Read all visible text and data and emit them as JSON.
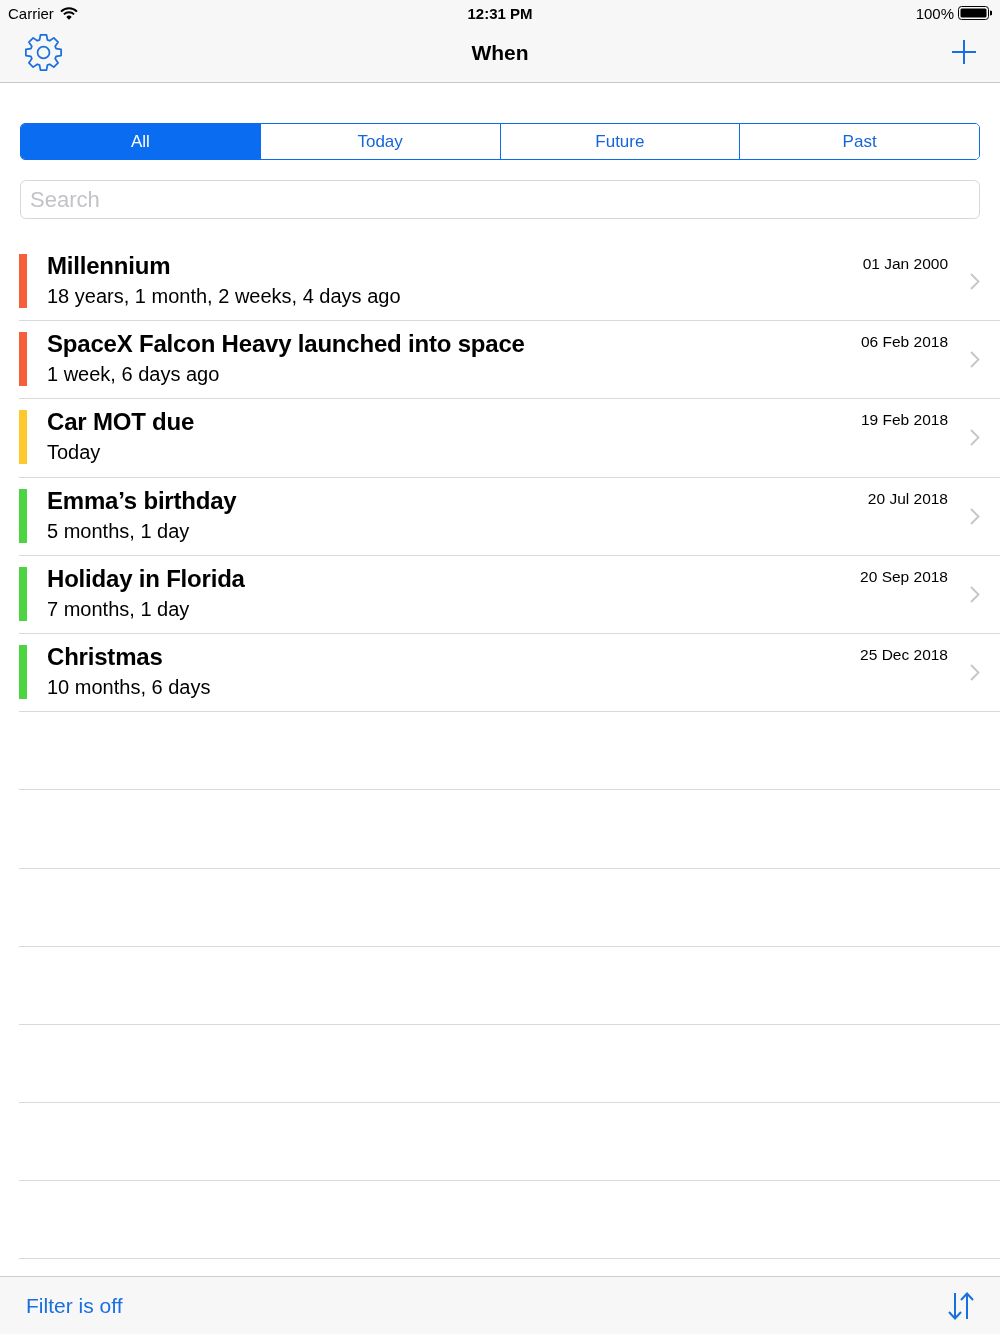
{
  "status_bar": {
    "carrier": "Carrier",
    "time": "12:31 PM",
    "battery": "100%"
  },
  "nav_bar": {
    "title": "When"
  },
  "segments": [
    {
      "label": "All",
      "selected": true
    },
    {
      "label": "Today",
      "selected": false
    },
    {
      "label": "Future",
      "selected": false
    },
    {
      "label": "Past",
      "selected": false
    }
  ],
  "search": {
    "placeholder": "Search"
  },
  "events": [
    {
      "title": "Millennium",
      "relative": "18 years, 1 month, 2 weeks, 4 days ago",
      "date": "01 Jan 2000",
      "color": "#f5603a"
    },
    {
      "title": "SpaceX Falcon Heavy launched into space",
      "relative": "1 week, 6 days ago",
      "date": "06 Feb 2018",
      "color": "#f5603a"
    },
    {
      "title": "Car MOT due",
      "relative": "Today",
      "date": "19 Feb 2018",
      "color": "#fdc92c"
    },
    {
      "title": "Emma’s birthday",
      "relative": "5 months, 1 day",
      "date": "20 Jul 2018",
      "color": "#4cd443"
    },
    {
      "title": "Holiday in Florida",
      "relative": "7 months, 1 day",
      "date": "20 Sep 2018",
      "color": "#4cd443"
    },
    {
      "title": "Christmas",
      "relative": "10 months, 6 days",
      "date": "25 Dec 2018",
      "color": "#4cd443"
    }
  ],
  "toolbar": {
    "filter_label": "Filter is off"
  }
}
